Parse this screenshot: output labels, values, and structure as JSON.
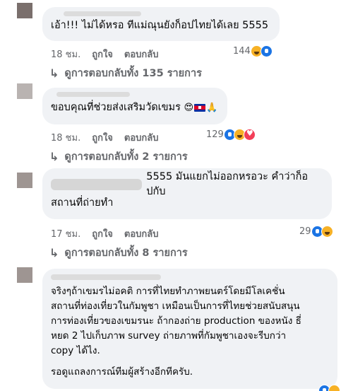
{
  "comments": [
    {
      "text": "เอ้า!!! ไม่ได้หรอ ทีแม่ณุนยังก็อปไทยได้เลย 5555",
      "time": "18 ชม.",
      "like_label": "ถูกใจ",
      "reply_label": "ตอบกลับ",
      "reaction_count": "144",
      "replies_label": "ดูการตอบกลับทั้ง 135 รายการ"
    },
    {
      "text": "ขอบคุณที่ช่วยส่งเสริมวัดเขมร",
      "time": "18 ชม.",
      "like_label": "ถูกใจ",
      "reply_label": "ตอบกลับ",
      "reaction_count": "129",
      "replies_label": "ดูการตอบกลับทั้ง 2 รายการ"
    },
    {
      "text_line1": "5555 มันแยกไม่ออกหรอวะ คำว่าก็อปกับ",
      "text_line2": "สถานที่ถ่ายทำ",
      "time": "17 ชม.",
      "like_label": "ถูกใจ",
      "reply_label": "ตอบกลับ",
      "reaction_count": "29",
      "replies_label": "ดูการตอบกลับทั้ง 8 รายการ"
    },
    {
      "line1": "จริงๆถ้าเขมรไม่อคติ การที่ไทยทำภาพยนตร์โดยมีโลเคชั่น",
      "line2": "สถานที่ท่องเที่ยวในกัมพูชา เหมือนเป็นการที่ไทยช่วยสนับสนุน",
      "line3": "การท่องเที่ยวของเขมรนะ ถ้ากองถ่าย production ของหนัง ธี่",
      "line4": "หยด 2 ไปเก็บภาพ survey ถ่ายภาพที่กัมพูชาเองจะรีบกว่า",
      "line5": "copy ได้ไง.",
      "line6": "รอดูแถลงการณ์ทีมผู้สร้างอีกทีครับ."
    }
  ]
}
